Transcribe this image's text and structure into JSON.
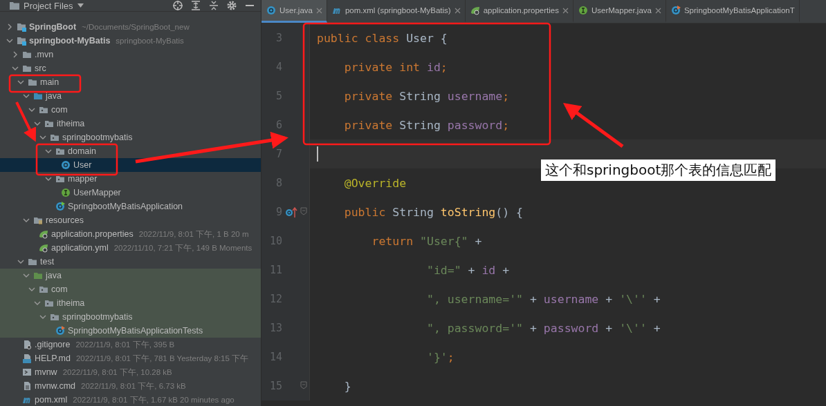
{
  "project_panel": {
    "title": "Project Files",
    "tree": [
      {
        "name": "SpringBoot",
        "meta": "~/Documents/SpringBoot_new",
        "kind": "module",
        "bold": true,
        "expanded": false,
        "selected": false,
        "highlighted": false
      },
      {
        "name": "springboot-MyBatis",
        "meta": "springboot-MyBatis",
        "kind": "module",
        "bold": true,
        "expanded": true,
        "selected": false,
        "highlighted": false,
        "children": [
          {
            "name": ".mvn",
            "kind": "folder",
            "expanded": false,
            "selected": false,
            "highlighted": false
          },
          {
            "name": "src",
            "kind": "folder",
            "expanded": true,
            "selected": false,
            "highlighted": false,
            "children": [
              {
                "name": "main",
                "kind": "folder",
                "expanded": true,
                "selected": false,
                "highlighted": false,
                "children": [
                  {
                    "name": "java",
                    "kind": "source-folder",
                    "expanded": true,
                    "selected": false,
                    "highlighted": false,
                    "children": [
                      {
                        "name": "com",
                        "kind": "package",
                        "expanded": true,
                        "selected": false,
                        "highlighted": false,
                        "children": [
                          {
                            "name": "itheima",
                            "kind": "package",
                            "expanded": true,
                            "selected": false,
                            "highlighted": false,
                            "children": [
                              {
                                "name": "springbootmybatis",
                                "kind": "package",
                                "expanded": true,
                                "selected": false,
                                "highlighted": false,
                                "children": [
                                  {
                                    "name": "domain",
                                    "kind": "package",
                                    "expanded": true,
                                    "selected": false,
                                    "highlighted": false,
                                    "children": [
                                      {
                                        "name": "User",
                                        "kind": "class",
                                        "selected": true,
                                        "highlighted": false
                                      }
                                    ]
                                  },
                                  {
                                    "name": "mapper",
                                    "kind": "package",
                                    "expanded": true,
                                    "selected": false,
                                    "highlighted": false,
                                    "children": [
                                      {
                                        "name": "UserMapper",
                                        "kind": "interface",
                                        "selected": false,
                                        "highlighted": false
                                      }
                                    ]
                                  },
                                  {
                                    "name": "SpringbootMyBatisApplication",
                                    "kind": "spring-app",
                                    "selected": false,
                                    "highlighted": false
                                  }
                                ]
                              }
                            ]
                          }
                        ]
                      }
                    ]
                  },
                  {
                    "name": "resources",
                    "kind": "resources",
                    "expanded": true,
                    "selected": false,
                    "highlighted": false,
                    "children": [
                      {
                        "name": "application.properties",
                        "meta": "2022/11/9, 8:01 下午, 1 B 20 m",
                        "kind": "spring-config",
                        "selected": false,
                        "highlighted": false
                      },
                      {
                        "name": "application.yml",
                        "meta": "2022/11/10, 7:21 下午, 149 B Moments",
                        "kind": "spring-config",
                        "selected": false,
                        "highlighted": false
                      }
                    ]
                  }
                ]
              },
              {
                "name": "test",
                "kind": "folder",
                "expanded": true,
                "selected": false,
                "highlighted": false,
                "children": [
                  {
                    "name": "java",
                    "kind": "test-folder",
                    "expanded": true,
                    "selected": false,
                    "highlighted": true,
                    "children": [
                      {
                        "name": "com",
                        "kind": "package",
                        "expanded": true,
                        "selected": false,
                        "highlighted": true,
                        "children": [
                          {
                            "name": "itheima",
                            "kind": "package",
                            "expanded": true,
                            "selected": false,
                            "highlighted": true,
                            "children": [
                              {
                                "name": "springbootmybatis",
                                "kind": "package",
                                "expanded": true,
                                "selected": false,
                                "highlighted": true,
                                "children": [
                                  {
                                    "name": "SpringbootMyBatisApplicationTests",
                                    "kind": "test-class",
                                    "selected": false,
                                    "highlighted": true
                                  }
                                ]
                              }
                            ]
                          }
                        ]
                      }
                    ]
                  }
                ]
              }
            ]
          },
          {
            "name": ".gitignore",
            "meta": "2022/11/9, 8:01 下午, 395 B",
            "kind": "gitignore",
            "selected": false,
            "highlighted": false
          },
          {
            "name": "HELP.md",
            "meta": "2022/11/9, 8:01 下午, 781 B Yesterday 8:15 下午",
            "kind": "markdown",
            "selected": false,
            "highlighted": false
          },
          {
            "name": "mvnw",
            "meta": "2022/11/9, 8:01 下午, 10.28 kB",
            "kind": "shell",
            "selected": false,
            "highlighted": false
          },
          {
            "name": "mvnw.cmd",
            "meta": "2022/11/9, 8:01 下午, 6.73 kB",
            "kind": "text-file",
            "selected": false,
            "highlighted": false
          },
          {
            "name": "pom.xml",
            "meta": "2022/11/9, 8:01 下午, 1.67 kB 20 minutes ago",
            "kind": "maven",
            "selected": false,
            "highlighted": false
          }
        ]
      }
    ]
  },
  "editor": {
    "tabs": [
      {
        "label": "User.java",
        "kind": "class",
        "selected": true
      },
      {
        "label": "pom.xml (springboot-MyBatis)",
        "kind": "maven",
        "selected": false
      },
      {
        "label": "application.properties",
        "kind": "spring-config",
        "selected": false
      },
      {
        "label": "UserMapper.java",
        "kind": "interface",
        "selected": false
      },
      {
        "label": "SpringbootMyBatisApplicationT",
        "kind": "test-class",
        "selected": false
      }
    ],
    "lines": [
      {
        "number": "3",
        "current": false,
        "tokens": [
          {
            "kind": "keyword",
            "text": "public class "
          },
          {
            "kind": "plain",
            "text": "User {"
          }
        ]
      },
      {
        "number": "4",
        "current": false,
        "tokens": [
          {
            "kind": "keyword",
            "text": "    private int "
          },
          {
            "kind": "field",
            "text": "id"
          },
          {
            "kind": "keyword",
            "text": ";"
          }
        ]
      },
      {
        "number": "5",
        "current": false,
        "tokens": [
          {
            "kind": "keyword",
            "text": "    private "
          },
          {
            "kind": "plain",
            "text": "String "
          },
          {
            "kind": "field",
            "text": "username"
          },
          {
            "kind": "keyword",
            "text": ";"
          }
        ]
      },
      {
        "number": "6",
        "current": false,
        "tokens": [
          {
            "kind": "keyword",
            "text": "    private "
          },
          {
            "kind": "plain",
            "text": "String "
          },
          {
            "kind": "field",
            "text": "password"
          },
          {
            "kind": "keyword",
            "text": ";"
          }
        ]
      },
      {
        "number": "7",
        "current": true
      },
      {
        "number": "8",
        "current": false,
        "tokens": [
          {
            "kind": "annotation",
            "text": "    @Override"
          }
        ]
      },
      {
        "number": "9",
        "current": false,
        "override": true,
        "fold": true,
        "tokens": [
          {
            "kind": "keyword",
            "text": "    public "
          },
          {
            "kind": "plain",
            "text": "String "
          },
          {
            "kind": "method",
            "text": "toString"
          },
          {
            "kind": "plain",
            "text": "() {"
          }
        ]
      },
      {
        "number": "10",
        "current": false,
        "tokens": [
          {
            "kind": "keyword",
            "text": "        return "
          },
          {
            "kind": "string",
            "text": "\"User{\""
          },
          {
            "kind": "plain",
            "text": " +"
          }
        ]
      },
      {
        "number": "11",
        "current": false,
        "tokens": [
          {
            "kind": "string",
            "text": "                \"id=\""
          },
          {
            "kind": "plain",
            "text": " + "
          },
          {
            "kind": "field",
            "text": "id"
          },
          {
            "kind": "plain",
            "text": " +"
          }
        ]
      },
      {
        "number": "12",
        "current": false,
        "tokens": [
          {
            "kind": "string",
            "text": "                \", username='\""
          },
          {
            "kind": "plain",
            "text": " + "
          },
          {
            "kind": "field",
            "text": "username"
          },
          {
            "kind": "plain",
            "text": " + "
          },
          {
            "kind": "string",
            "text": "'\\''"
          },
          {
            "kind": "plain",
            "text": " +"
          }
        ]
      },
      {
        "number": "13",
        "current": false,
        "tokens": [
          {
            "kind": "string",
            "text": "                \", password='\""
          },
          {
            "kind": "plain",
            "text": " + "
          },
          {
            "kind": "field",
            "text": "password"
          },
          {
            "kind": "plain",
            "text": " + "
          },
          {
            "kind": "string",
            "text": "'\\''"
          },
          {
            "kind": "plain",
            "text": " +"
          }
        ]
      },
      {
        "number": "14",
        "current": false,
        "tokens": [
          {
            "kind": "string",
            "text": "                '}'"
          },
          {
            "kind": "keyword",
            "text": ";"
          }
        ]
      },
      {
        "number": "15",
        "current": false,
        "fold": true,
        "tokens": [
          {
            "kind": "plain",
            "text": "    }"
          }
        ]
      }
    ]
  },
  "annotation_note": "这个和springboot那个表的信息匹配"
}
